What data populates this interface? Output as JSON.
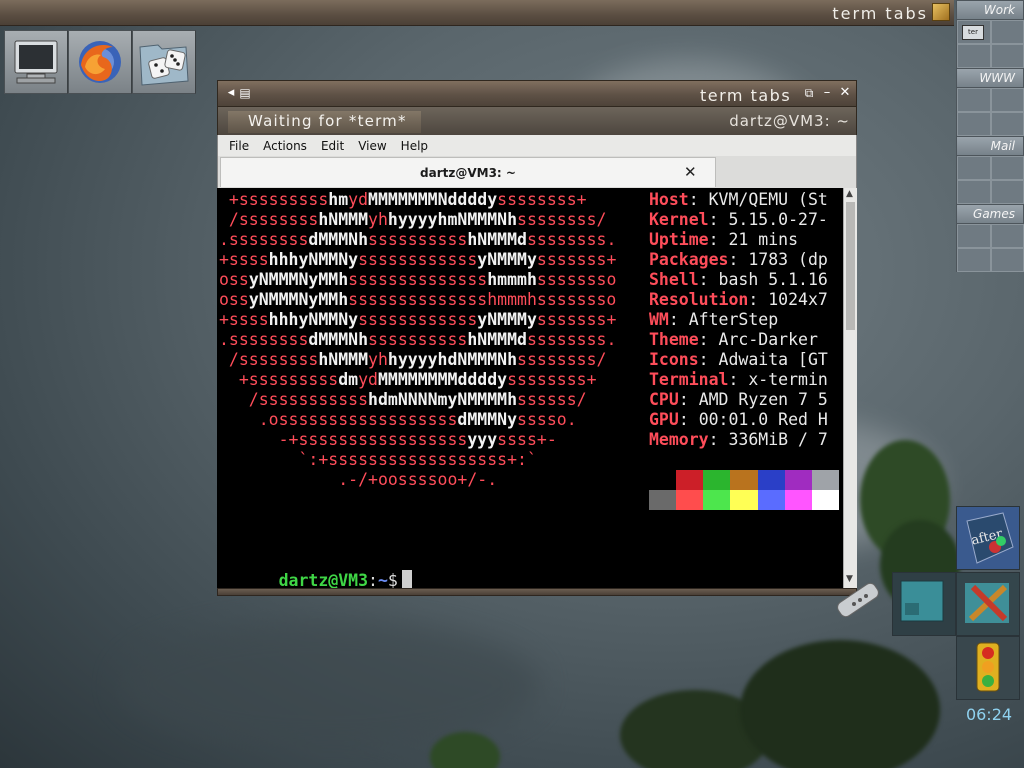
{
  "topbar": {
    "title": "term tabs"
  },
  "launcher": [
    {
      "icon": "monitor-icon"
    },
    {
      "icon": "firefox-icon"
    },
    {
      "icon": "dice-folder-icon"
    }
  ],
  "pager": {
    "desks": [
      {
        "label": "Work"
      },
      {
        "label": "WWW"
      },
      {
        "label": "Mail"
      },
      {
        "label": "Games"
      }
    ],
    "mini_window_label": "ter"
  },
  "window": {
    "title": "term tabs",
    "tab_label": "Waiting for *term*",
    "host": "dartz@VM3: ~",
    "menu": [
      "File",
      "Actions",
      "Edit",
      "View",
      "Help"
    ],
    "tab_title": "dartz@VM3: ~"
  },
  "terminal": {
    "ascii": [
      [
        [
          "r",
          " +sssssssss"
        ],
        [
          "w",
          "hm"
        ],
        [
          "r",
          "yd"
        ],
        [
          "w",
          "MMMMMMMNddddy"
        ],
        [
          "r",
          "ssssssss+"
        ]
      ],
      [
        [
          "r",
          " /ssssssss"
        ],
        [
          "w",
          "hNMMM"
        ],
        [
          "r",
          "yh"
        ],
        [
          "w",
          "hyyyyhmNMMMNh"
        ],
        [
          "r",
          "ssssssss/"
        ]
      ],
      [
        [
          "r",
          ".ssssssss"
        ],
        [
          "w",
          "dMMMNh"
        ],
        [
          "r",
          "ssssssssss"
        ],
        [
          "w",
          "hNMMMd"
        ],
        [
          "r",
          "ssssssss."
        ]
      ],
      [
        [
          "r",
          "+ssss"
        ],
        [
          "w",
          "hhhyNMMNy"
        ],
        [
          "r",
          "ssssssssssss"
        ],
        [
          "w",
          "yNMMMy"
        ],
        [
          "r",
          "sssssss+"
        ]
      ],
      [
        [
          "r",
          "oss"
        ],
        [
          "w",
          "yNMMMNyMMh"
        ],
        [
          "r",
          "ssssssssssssss"
        ],
        [
          "w",
          "hmmmh"
        ],
        [
          "r",
          "ssssssso"
        ]
      ],
      [
        [
          "r",
          "oss"
        ],
        [
          "w",
          "yNMMMNyMMh"
        ],
        [
          "r",
          "sssssssssssssshmmmhssssssso"
        ]
      ],
      [
        [
          "r",
          "+ssss"
        ],
        [
          "w",
          "hhhyNMMNy"
        ],
        [
          "r",
          "ssssssssssss"
        ],
        [
          "w",
          "yNMMMy"
        ],
        [
          "r",
          "sssssss+"
        ]
      ],
      [
        [
          "r",
          ".ssssssss"
        ],
        [
          "w",
          "dMMMNh"
        ],
        [
          "r",
          "ssssssssss"
        ],
        [
          "w",
          "hNMMMd"
        ],
        [
          "r",
          "ssssssss."
        ]
      ],
      [
        [
          "r",
          " /ssssssss"
        ],
        [
          "w",
          "hNMMM"
        ],
        [
          "r",
          "yh"
        ],
        [
          "w",
          "hyyyyhdNMMMNh"
        ],
        [
          "r",
          "ssssssss/"
        ]
      ],
      [
        [
          "r",
          "  +sssssssss"
        ],
        [
          "w",
          "dm"
        ],
        [
          "r",
          "yd"
        ],
        [
          "w",
          "MMMMMMMMddddy"
        ],
        [
          "r",
          "ssssssss+"
        ]
      ],
      [
        [
          "r",
          "   /sssssssssss"
        ],
        [
          "w",
          "hdmNNNNmyNMMMMh"
        ],
        [
          "r",
          "ssssss/"
        ]
      ],
      [
        [
          "r",
          "    .ossssssssssssssssss"
        ],
        [
          "w",
          "dMMMNy"
        ],
        [
          "r",
          "sssso."
        ]
      ],
      [
        [
          "r",
          "      -+sssssssssssssssss"
        ],
        [
          "w",
          "yyy"
        ],
        [
          "r",
          "ssss+-"
        ]
      ],
      [
        [
          "r",
          "        `:+ssssssssssssssssss+:`"
        ]
      ],
      [
        [
          "r",
          "            .-/+oossssoo+/-."
        ]
      ]
    ],
    "info": [
      {
        "key": "Host",
        "value": "KVM/QEMU (St"
      },
      {
        "key": "Kernel",
        "value": "5.15.0-27-"
      },
      {
        "key": "Uptime",
        "value": "21 mins"
      },
      {
        "key": "Packages",
        "value": "1783 (dp"
      },
      {
        "key": "Shell",
        "value": "bash 5.1.16"
      },
      {
        "key": "Resolution",
        "value": "1024x7"
      },
      {
        "key": "WM",
        "value": "AfterStep"
      },
      {
        "key": "Theme",
        "value": "Arc-Darker"
      },
      {
        "key": "Icons",
        "value": "Adwaita [GT"
      },
      {
        "key": "Terminal",
        "value": "x-termin"
      },
      {
        "key": "CPU",
        "value": "AMD Ryzen 7 5"
      },
      {
        "key": "GPU",
        "value": "00:01.0 Red H"
      },
      {
        "key": "Memory",
        "value": "336MiB / 7"
      }
    ],
    "palette": [
      [
        "#000000",
        "#cc1f28",
        "#2bb52e",
        "#b9731e",
        "#2a3fc7",
        "#a02cc0",
        "#9fa3a8"
      ],
      [
        "#6a6a6a",
        "#ff4d4d",
        "#4de64d",
        "#ffff55",
        "#5a6cff",
        "#ff55ff",
        "#ffffff"
      ]
    ],
    "prompt_user": "dartz@VM3",
    "prompt_path": "~",
    "prompt_symbol": "$"
  },
  "wharf": {
    "clock": "06:24",
    "items": [
      "afterstep-logo-icon",
      "remote-control-icon",
      "desktop-screen-icon",
      "tools-icon",
      "traffic-light-icon"
    ]
  }
}
